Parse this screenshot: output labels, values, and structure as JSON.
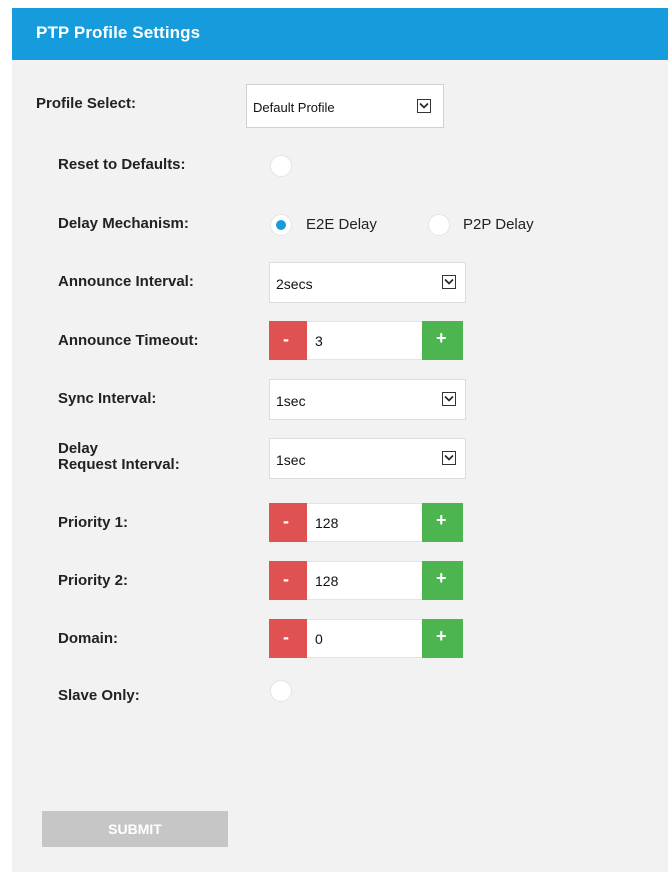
{
  "header": {
    "title": "PTP Profile Settings"
  },
  "profile_select": {
    "label": "Profile Select:",
    "value": "Default Profile"
  },
  "reset": {
    "label": "Reset to Defaults:"
  },
  "delay_mechanism": {
    "label": "Delay Mechanism:",
    "options": [
      "E2E Delay",
      "P2P Delay"
    ],
    "selected": "E2E Delay"
  },
  "announce_interval": {
    "label": "Announce Interval:",
    "value": "2secs"
  },
  "announce_timeout": {
    "label": "Announce Timeout:",
    "value": "3"
  },
  "sync_interval": {
    "label": "Sync Interval:",
    "value": "1sec"
  },
  "delay_request_interval": {
    "label_line1": "Delay",
    "label_line2": "Request Interval:",
    "value": "1sec"
  },
  "priority1": {
    "label": "Priority 1:",
    "value": "128"
  },
  "priority2": {
    "label": "Priority 2:",
    "value": "128"
  },
  "domain": {
    "label": "Domain:",
    "value": "0"
  },
  "slave_only": {
    "label": "Slave Only:"
  },
  "stepper": {
    "minus_label": "-",
    "plus_label": "+"
  },
  "submit": {
    "label": "SUBMIT"
  },
  "colors": {
    "header": "#169cdc",
    "minus": "#e05252",
    "plus": "#4cb550",
    "submit_disabled": "#c6c6c6",
    "radio_selected": "#169cdc"
  },
  "icons": [
    "chevron-down-icon",
    "minus-icon",
    "plus-icon"
  ]
}
